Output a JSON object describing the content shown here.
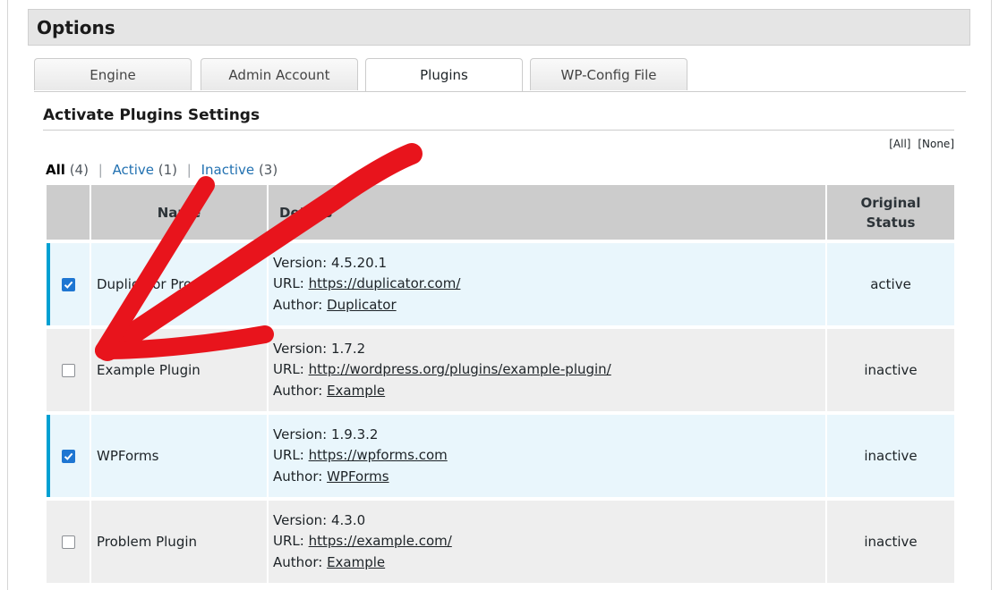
{
  "options": {
    "title": "Options"
  },
  "tabs": [
    {
      "label": "Engine",
      "active": false
    },
    {
      "label": "Admin Account",
      "active": false
    },
    {
      "label": "Plugins",
      "active": true
    },
    {
      "label": "WP-Config File",
      "active": false
    }
  ],
  "section": {
    "title": "Activate Plugins Settings"
  },
  "select_links": {
    "all": "[All]",
    "none": "[None]"
  },
  "filters": {
    "all": {
      "label": "All",
      "count": "(4)"
    },
    "active": {
      "label": "Active",
      "count": "(1)"
    },
    "inactive": {
      "label": "Inactive",
      "count": "(3)"
    },
    "separator": "|"
  },
  "table": {
    "headers": {
      "name": "Name",
      "details": "Details",
      "status_line1": "Original",
      "status_line2": "Status"
    },
    "version_label": "Version:",
    "url_label": "URL:",
    "author_label": "Author:",
    "rows": [
      {
        "checked": true,
        "name": "Duplicator Pro",
        "version": "4.5.20.1",
        "url": "https://duplicator.com/",
        "author": "Duplicator",
        "status": "active"
      },
      {
        "checked": false,
        "name": "Example Plugin",
        "version": "1.7.2",
        "url": "http://wordpress.org/plugins/example-plugin/",
        "author": "Example",
        "status": "inactive"
      },
      {
        "checked": true,
        "name": "WPForms",
        "version": "1.9.3.2",
        "url": "https://wpforms.com",
        "author": "WPForms",
        "status": "inactive"
      },
      {
        "checked": false,
        "name": "Problem Plugin",
        "version": "4.3.0",
        "url": "https://example.com/",
        "author": "Example",
        "status": "inactive"
      }
    ]
  },
  "colors": {
    "accent": "#00a0d2",
    "checkbox": "#1e76d2",
    "link": "#2271b1",
    "annotation_arrow": "#e8141c"
  }
}
